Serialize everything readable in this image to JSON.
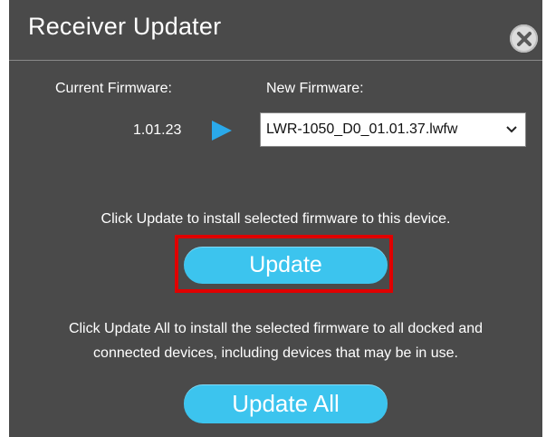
{
  "dialog": {
    "title": "Receiver Updater",
    "close_icon": "close-icon",
    "labels": {
      "current_firmware": "Current Firmware:",
      "new_firmware": "New Firmware:"
    },
    "current_version": "1.01.23",
    "arrow_icon": "play-arrow-icon",
    "firmware_select": {
      "selected": "LWR-1050_D0_01.01.37.lwfw",
      "chevron_icon": "chevron-down-icon"
    },
    "instruction_update": "Click Update to install selected firmware to this device.",
    "update_button": "Update",
    "instruction_update_all": [
      "Click Update All to install the selected firmware to all docked and",
      "connected devices, including devices that may be in use."
    ],
    "update_all_button": "Update All"
  },
  "colors": {
    "background": "#4a4a4a",
    "accent": "#3cc4ee",
    "arrow": "#2aa9ea",
    "highlight": "#e00000"
  }
}
